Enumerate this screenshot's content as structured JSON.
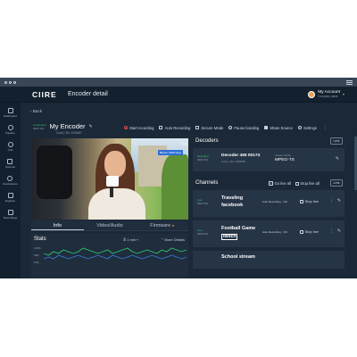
{
  "app": {
    "logo": "CIIRE",
    "page_title": "Encoder detail"
  },
  "account": {
    "name": "My Account",
    "sub": "Company name"
  },
  "sidebar": {
    "items": [
      {
        "label": "Dashboard"
      },
      {
        "label": "Pipeline"
      },
      {
        "label": "Grid"
      },
      {
        "label": "Sources"
      },
      {
        "label": "Destinations"
      },
      {
        "label": "Engines"
      },
      {
        "label": "Recordings"
      }
    ]
  },
  "back": "‹ Back",
  "encoder": {
    "status": "Connected",
    "status_sub": "999h 59s",
    "name": "My Encoder",
    "sub": "Cube | SN: 1030087"
  },
  "actions": {
    "start_recording": "Start recording",
    "auto_recording": "Auto Recording",
    "secure_mode": "Secure Mode",
    "pause_bonding": "Pause bonding",
    "share_source": "Share Source",
    "settings": "Settings"
  },
  "video": {
    "badge": "Bitrate: 6200 kbps",
    "badge2": "Live"
  },
  "tabs": [
    {
      "label": "Info"
    },
    {
      "label": "Video/Audio"
    },
    {
      "label": "Firmware"
    }
  ],
  "stats": {
    "title": "Stats",
    "range": "1 min",
    "more": "More Details",
    "y_labels": [
      "10Mb",
      "5Mb",
      "1Mb"
    ]
  },
  "decoders": {
    "title": "Decoders",
    "link": "Link",
    "items": [
      {
        "status": "Decoding",
        "status_sub": "999h 59s",
        "name": "Decoder 455 00174",
        "sub": "Cube | SN: 1035689",
        "format_label": "Stream Mode",
        "format": "MPEG-TS"
      }
    ]
  },
  "channels": {
    "title": "Channels",
    "go_live_all": "Go live all",
    "stop_live_all": "Stop live all",
    "link": "Link",
    "items": [
      {
        "status": "Live",
        "status_sub": "999h 59s",
        "name": "Traveling",
        "platform": "facebook",
        "meta": "Auto Recording · ON",
        "stop": "Stop live"
      },
      {
        "status": "Live",
        "status_sub": "999h 59s",
        "name": "Football Game",
        "platform": "twitch",
        "meta": "Auto Recording · ON",
        "stop": "Stop live"
      },
      {
        "name": "School stream"
      }
    ]
  },
  "colors": {
    "bg": "#1b2838",
    "panel": "#263546",
    "live": "#2ecc71",
    "record": "#e24b4b",
    "chart": "#2ecc71"
  },
  "chart_data": {
    "type": "line",
    "series": [
      {
        "values": [
          6,
          5,
          7,
          6,
          8,
          7,
          6,
          7,
          9,
          8,
          7,
          6,
          7,
          8,
          6,
          7,
          8,
          9,
          7,
          6,
          7,
          8,
          7,
          6,
          8,
          7,
          9,
          8,
          7,
          8
        ]
      },
      {
        "values": [
          3,
          4,
          3,
          5,
          4,
          3,
          4,
          5,
          4,
          3,
          4,
          5,
          4,
          3,
          5,
          4,
          3,
          4,
          5,
          4,
          3,
          4,
          5,
          4,
          3,
          4,
          5,
          4,
          3,
          4
        ]
      }
    ],
    "ylim": [
      0,
      10
    ]
  }
}
